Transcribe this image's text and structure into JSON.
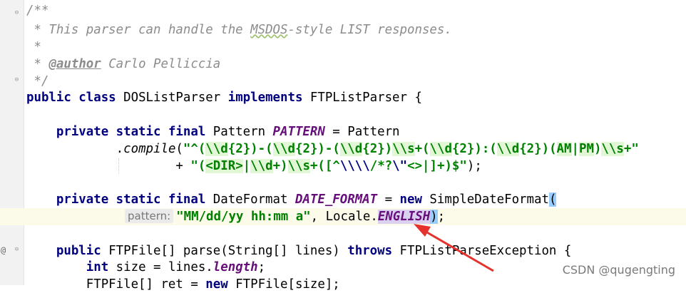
{
  "editor": {
    "lines": [
      {
        "indent": "",
        "segments": [
          {
            "cls": "comment",
            "text": "/**"
          }
        ]
      },
      {
        "indent": " ",
        "segments": [
          {
            "cls": "comment",
            "text": "* This parser can handle the "
          },
          {
            "cls": "comment squiggle",
            "text": "MSDOS"
          },
          {
            "cls": "comment",
            "text": "-style LIST responses."
          }
        ]
      },
      {
        "indent": " ",
        "segments": [
          {
            "cls": "comment",
            "text": "*"
          }
        ]
      },
      {
        "indent": " ",
        "segments": [
          {
            "cls": "comment",
            "text": "* "
          },
          {
            "cls": "tag",
            "text": "@author"
          },
          {
            "cls": "comment",
            "text": " Carlo Pelliccia"
          }
        ]
      },
      {
        "indent": " ",
        "segments": [
          {
            "cls": "comment",
            "text": "*/"
          }
        ]
      },
      {
        "indent": "",
        "segments": [
          {
            "cls": "kw",
            "text": "public class "
          },
          {
            "cls": "",
            "text": "DOSListParser "
          },
          {
            "cls": "kw",
            "text": "implements "
          },
          {
            "cls": "",
            "text": "FTPListParser {"
          }
        ]
      },
      {
        "indent": "",
        "segments": []
      },
      {
        "indent": "    ",
        "segments": [
          {
            "cls": "kw",
            "text": "private static final "
          },
          {
            "cls": "",
            "text": "Pattern "
          },
          {
            "cls": "field",
            "text": "PATTERN"
          },
          {
            "cls": "",
            "text": " = Pattern"
          }
        ]
      },
      {
        "indent": "            ",
        "segments": [
          {
            "cls": "",
            "text": "."
          },
          {
            "cls": "method",
            "text": "compile"
          },
          {
            "cls": "",
            "text": "("
          },
          {
            "cls": "str",
            "text": "\"^("
          },
          {
            "cls": "str-hl",
            "text": "\\\\d"
          },
          {
            "cls": "str",
            "text": "{2})-("
          },
          {
            "cls": "str-hl",
            "text": "\\\\d"
          },
          {
            "cls": "str",
            "text": "{2})-("
          },
          {
            "cls": "str-hl",
            "text": "\\\\d"
          },
          {
            "cls": "str",
            "text": "{2})"
          },
          {
            "cls": "str-hl",
            "text": "\\\\s"
          },
          {
            "cls": "str",
            "text": "+("
          },
          {
            "cls": "str-hl",
            "text": "\\\\d"
          },
          {
            "cls": "str",
            "text": "{2}):("
          },
          {
            "cls": "str-hl",
            "text": "\\\\d"
          },
          {
            "cls": "str",
            "text": "{2})("
          },
          {
            "cls": "str-hl",
            "text": "AM"
          },
          {
            "cls": "str",
            "text": "|"
          },
          {
            "cls": "str-hl",
            "text": "PM"
          },
          {
            "cls": "str",
            "text": ")"
          },
          {
            "cls": "str-hl",
            "text": "\\\\s"
          },
          {
            "cls": "str",
            "text": "+\""
          }
        ]
      },
      {
        "indent": "                    ",
        "segments": [
          {
            "cls": "",
            "text": "+ "
          },
          {
            "cls": "str",
            "text": "\"("
          },
          {
            "cls": "str-hl",
            "text": "<DIR>"
          },
          {
            "cls": "str",
            "text": "|"
          },
          {
            "cls": "str-hl",
            "text": "\\\\d"
          },
          {
            "cls": "str",
            "text": "+)"
          },
          {
            "cls": "str-hl",
            "text": "\\\\s"
          },
          {
            "cls": "str",
            "text": "+([^"
          },
          {
            "cls": "esc",
            "text": "\\\\\\\\"
          },
          {
            "cls": "str",
            "text": "/*?"
          },
          {
            "cls": "esc",
            "text": "\\\""
          },
          {
            "cls": "str",
            "text": "<>|]+)$\""
          },
          {
            "cls": "",
            "text": ");"
          }
        ]
      },
      {
        "indent": "",
        "segments": []
      },
      {
        "indent": "    ",
        "segments": [
          {
            "cls": "kw",
            "text": "private static final "
          },
          {
            "cls": "",
            "text": "DateFormat "
          },
          {
            "cls": "field",
            "text": "DATE_FORMAT"
          },
          {
            "cls": "",
            "text": " = "
          },
          {
            "cls": "kw",
            "text": "new "
          },
          {
            "cls": "",
            "text": "SimpleDateFormat"
          },
          {
            "cls": "paren-hl",
            "text": "("
          }
        ]
      },
      {
        "indent": "",
        "segments": [
          {
            "cls": "hint",
            "text": "pattern:"
          },
          {
            "cls": "str",
            "text": "\"MM/dd/yy hh:mm a\""
          },
          {
            "cls": "",
            "text": ", Locale."
          },
          {
            "cls": "field ident-hl",
            "text": "ENGLISH"
          },
          {
            "cls": "paren-hl",
            "text": ")"
          },
          {
            "cls": "",
            "text": ";"
          }
        ],
        "current": true,
        "pad": 138
      },
      {
        "indent": "",
        "segments": []
      },
      {
        "indent": "    ",
        "segments": [
          {
            "cls": "kw",
            "text": "public "
          },
          {
            "cls": "",
            "text": "FTPFile[] parse(String[] lines) "
          },
          {
            "cls": "kw",
            "text": "throws "
          },
          {
            "cls": "",
            "text": "FTPListParseException {"
          }
        ]
      },
      {
        "indent": "        ",
        "segments": [
          {
            "cls": "kw",
            "text": "int "
          },
          {
            "cls": "",
            "text": "size = lines."
          },
          {
            "cls": "field",
            "text": "length"
          },
          {
            "cls": "",
            "text": ";"
          }
        ]
      },
      {
        "indent": "        ",
        "segments": [
          {
            "cls": "",
            "text": "FTPFile[] ret = "
          },
          {
            "cls": "kw",
            "text": "new "
          },
          {
            "cls": "",
            "text": "FTPFile[size];"
          }
        ]
      }
    ]
  },
  "watermark": "CSDN @qugengting",
  "colors": {
    "keyword": "#000080",
    "string": "#008000",
    "field": "#660e7a",
    "comment": "#8c8c8c",
    "arrow": "#e5322d"
  }
}
